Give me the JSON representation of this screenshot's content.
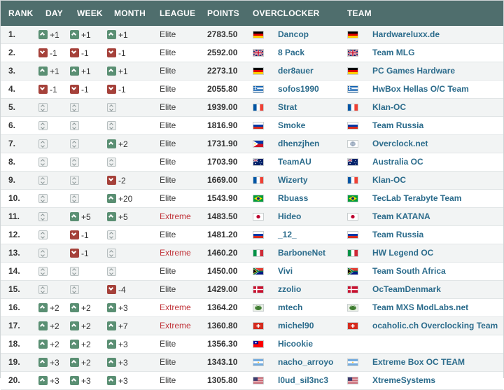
{
  "headers": {
    "rank": "RANK",
    "day": "DAY",
    "week": "WEEK",
    "month": "MONTH",
    "league": "LEAGUE",
    "points": "POINTS",
    "overclocker": "OVERCLOCKER",
    "team": "TEAM"
  },
  "colors": {
    "header_bg": "#4f6e6d",
    "up": "#5a8f73",
    "down": "#a5413a",
    "link": "#2c6c8c",
    "extreme": "#c0343a"
  },
  "rows": [
    {
      "rank": "1.",
      "day": {
        "dir": "up",
        "val": "+1"
      },
      "week": {
        "dir": "up",
        "val": "+1"
      },
      "month": {
        "dir": "up",
        "val": "+1"
      },
      "league": "Elite",
      "points": "2783.50",
      "oc_flag": "germany",
      "oc": "Dancop",
      "team_flag": "germany",
      "team": "Hardwareluxx.de"
    },
    {
      "rank": "2.",
      "day": {
        "dir": "down",
        "val": "-1"
      },
      "week": {
        "dir": "down",
        "val": "-1"
      },
      "month": {
        "dir": "down",
        "val": "-1"
      },
      "league": "Elite",
      "points": "2592.00",
      "oc_flag": "uk",
      "oc": "8 Pack",
      "team_flag": "uk",
      "team": "Team MLG"
    },
    {
      "rank": "3.",
      "day": {
        "dir": "up",
        "val": "+1"
      },
      "week": {
        "dir": "up",
        "val": "+1"
      },
      "month": {
        "dir": "up",
        "val": "+1"
      },
      "league": "Elite",
      "points": "2273.10",
      "oc_flag": "germany",
      "oc": "der8auer",
      "team_flag": "germany",
      "team": "PC Games Hardware"
    },
    {
      "rank": "4.",
      "day": {
        "dir": "down",
        "val": "-1"
      },
      "week": {
        "dir": "down",
        "val": "-1"
      },
      "month": {
        "dir": "down",
        "val": "-1"
      },
      "league": "Elite",
      "points": "2055.80",
      "oc_flag": "greece",
      "oc": "sofos1990",
      "team_flag": "greece",
      "team": "HwBox Hellas O/C Team"
    },
    {
      "rank": "5.",
      "day": {
        "dir": "same",
        "val": ""
      },
      "week": {
        "dir": "same",
        "val": ""
      },
      "month": {
        "dir": "same",
        "val": ""
      },
      "league": "Elite",
      "points": "1939.00",
      "oc_flag": "france",
      "oc": "Strat",
      "team_flag": "france",
      "team": "Klan-OC"
    },
    {
      "rank": "6.",
      "day": {
        "dir": "same",
        "val": ""
      },
      "week": {
        "dir": "same",
        "val": ""
      },
      "month": {
        "dir": "same",
        "val": ""
      },
      "league": "Elite",
      "points": "1816.90",
      "oc_flag": "russia",
      "oc": "Smoke",
      "team_flag": "russia",
      "team": "Team Russia"
    },
    {
      "rank": "7.",
      "day": {
        "dir": "same",
        "val": ""
      },
      "week": {
        "dir": "same",
        "val": ""
      },
      "month": {
        "dir": "up",
        "val": "+2"
      },
      "league": "Elite",
      "points": "1731.90",
      "oc_flag": "philippines",
      "oc": "dhenzjhen",
      "team_flag": "globe",
      "team": "Overclock.net"
    },
    {
      "rank": "8.",
      "day": {
        "dir": "same",
        "val": ""
      },
      "week": {
        "dir": "same",
        "val": ""
      },
      "month": {
        "dir": "same",
        "val": ""
      },
      "league": "Elite",
      "points": "1703.90",
      "oc_flag": "australia",
      "oc": "TeamAU",
      "team_flag": "australia",
      "team": "Australia OC"
    },
    {
      "rank": "9.",
      "day": {
        "dir": "same",
        "val": ""
      },
      "week": {
        "dir": "same",
        "val": ""
      },
      "month": {
        "dir": "down",
        "val": "-2"
      },
      "league": "Elite",
      "points": "1669.00",
      "oc_flag": "france",
      "oc": "Wizerty",
      "team_flag": "france",
      "team": "Klan-OC"
    },
    {
      "rank": "10.",
      "day": {
        "dir": "same",
        "val": ""
      },
      "week": {
        "dir": "same",
        "val": ""
      },
      "month": {
        "dir": "up",
        "val": "+20"
      },
      "league": "Elite",
      "points": "1543.90",
      "oc_flag": "brazil",
      "oc": "Rbuass",
      "team_flag": "brazil",
      "team": "TecLab Terabyte Team"
    },
    {
      "rank": "11.",
      "day": {
        "dir": "same",
        "val": ""
      },
      "week": {
        "dir": "up",
        "val": "+5"
      },
      "month": {
        "dir": "up",
        "val": "+5"
      },
      "league": "Extreme",
      "points": "1483.50",
      "oc_flag": "japan",
      "oc": "Hideo",
      "team_flag": "japan",
      "team": "Team KATANA"
    },
    {
      "rank": "12.",
      "day": {
        "dir": "same",
        "val": ""
      },
      "week": {
        "dir": "down",
        "val": "-1"
      },
      "month": {
        "dir": "same",
        "val": ""
      },
      "league": "Elite",
      "points": "1481.20",
      "oc_flag": "russia",
      "oc": "_12_",
      "team_flag": "russia",
      "team": "Team Russia"
    },
    {
      "rank": "13.",
      "day": {
        "dir": "same",
        "val": ""
      },
      "week": {
        "dir": "down",
        "val": "-1"
      },
      "month": {
        "dir": "same",
        "val": ""
      },
      "league": "Extreme",
      "points": "1460.20",
      "oc_flag": "italy",
      "oc": "BarboneNet",
      "team_flag": "italy",
      "team": "HW Legend OC"
    },
    {
      "rank": "14.",
      "day": {
        "dir": "same",
        "val": ""
      },
      "week": {
        "dir": "same",
        "val": ""
      },
      "month": {
        "dir": "same",
        "val": ""
      },
      "league": "Elite",
      "points": "1450.00",
      "oc_flag": "southafrica",
      "oc": "Vivi",
      "team_flag": "southafrica",
      "team": "Team South Africa"
    },
    {
      "rank": "15.",
      "day": {
        "dir": "same",
        "val": ""
      },
      "week": {
        "dir": "same",
        "val": ""
      },
      "month": {
        "dir": "down",
        "val": "-4"
      },
      "league": "Elite",
      "points": "1429.00",
      "oc_flag": "denmark",
      "oc": "zzolio",
      "team_flag": "denmark",
      "team": "OcTeamDenmark"
    },
    {
      "rank": "16.",
      "day": {
        "dir": "up",
        "val": "+2"
      },
      "week": {
        "dir": "up",
        "val": "+2"
      },
      "month": {
        "dir": "up",
        "val": "+3"
      },
      "league": "Extreme",
      "points": "1364.20",
      "oc_flag": "frog",
      "oc": "mtech",
      "team_flag": "frog",
      "team": "Team MXS ModLabs.net"
    },
    {
      "rank": "17.",
      "day": {
        "dir": "up",
        "val": "+2"
      },
      "week": {
        "dir": "up",
        "val": "+2"
      },
      "month": {
        "dir": "up",
        "val": "+7"
      },
      "league": "Extreme",
      "points": "1360.80",
      "oc_flag": "switzerland",
      "oc": "michel90",
      "team_flag": "switzerland",
      "team": "ocaholic.ch Overclocking Team"
    },
    {
      "rank": "18.",
      "day": {
        "dir": "up",
        "val": "+2"
      },
      "week": {
        "dir": "up",
        "val": "+2"
      },
      "month": {
        "dir": "up",
        "val": "+3"
      },
      "league": "Elite",
      "points": "1356.30",
      "oc_flag": "taiwan",
      "oc": "Hicookie",
      "team_flag": "",
      "team": ""
    },
    {
      "rank": "19.",
      "day": {
        "dir": "up",
        "val": "+3"
      },
      "week": {
        "dir": "up",
        "val": "+2"
      },
      "month": {
        "dir": "up",
        "val": "+3"
      },
      "league": "Elite",
      "points": "1343.10",
      "oc_flag": "argentina",
      "oc": "nacho_arroyo",
      "team_flag": "argentina",
      "team": "Extreme Box OC TEAM"
    },
    {
      "rank": "20.",
      "day": {
        "dir": "up",
        "val": "+3"
      },
      "week": {
        "dir": "up",
        "val": "+3"
      },
      "month": {
        "dir": "up",
        "val": "+3"
      },
      "league": "Elite",
      "points": "1305.80",
      "oc_flag": "usa",
      "oc": "l0ud_sil3nc3",
      "team_flag": "usa",
      "team": "XtremeSystems"
    }
  ]
}
